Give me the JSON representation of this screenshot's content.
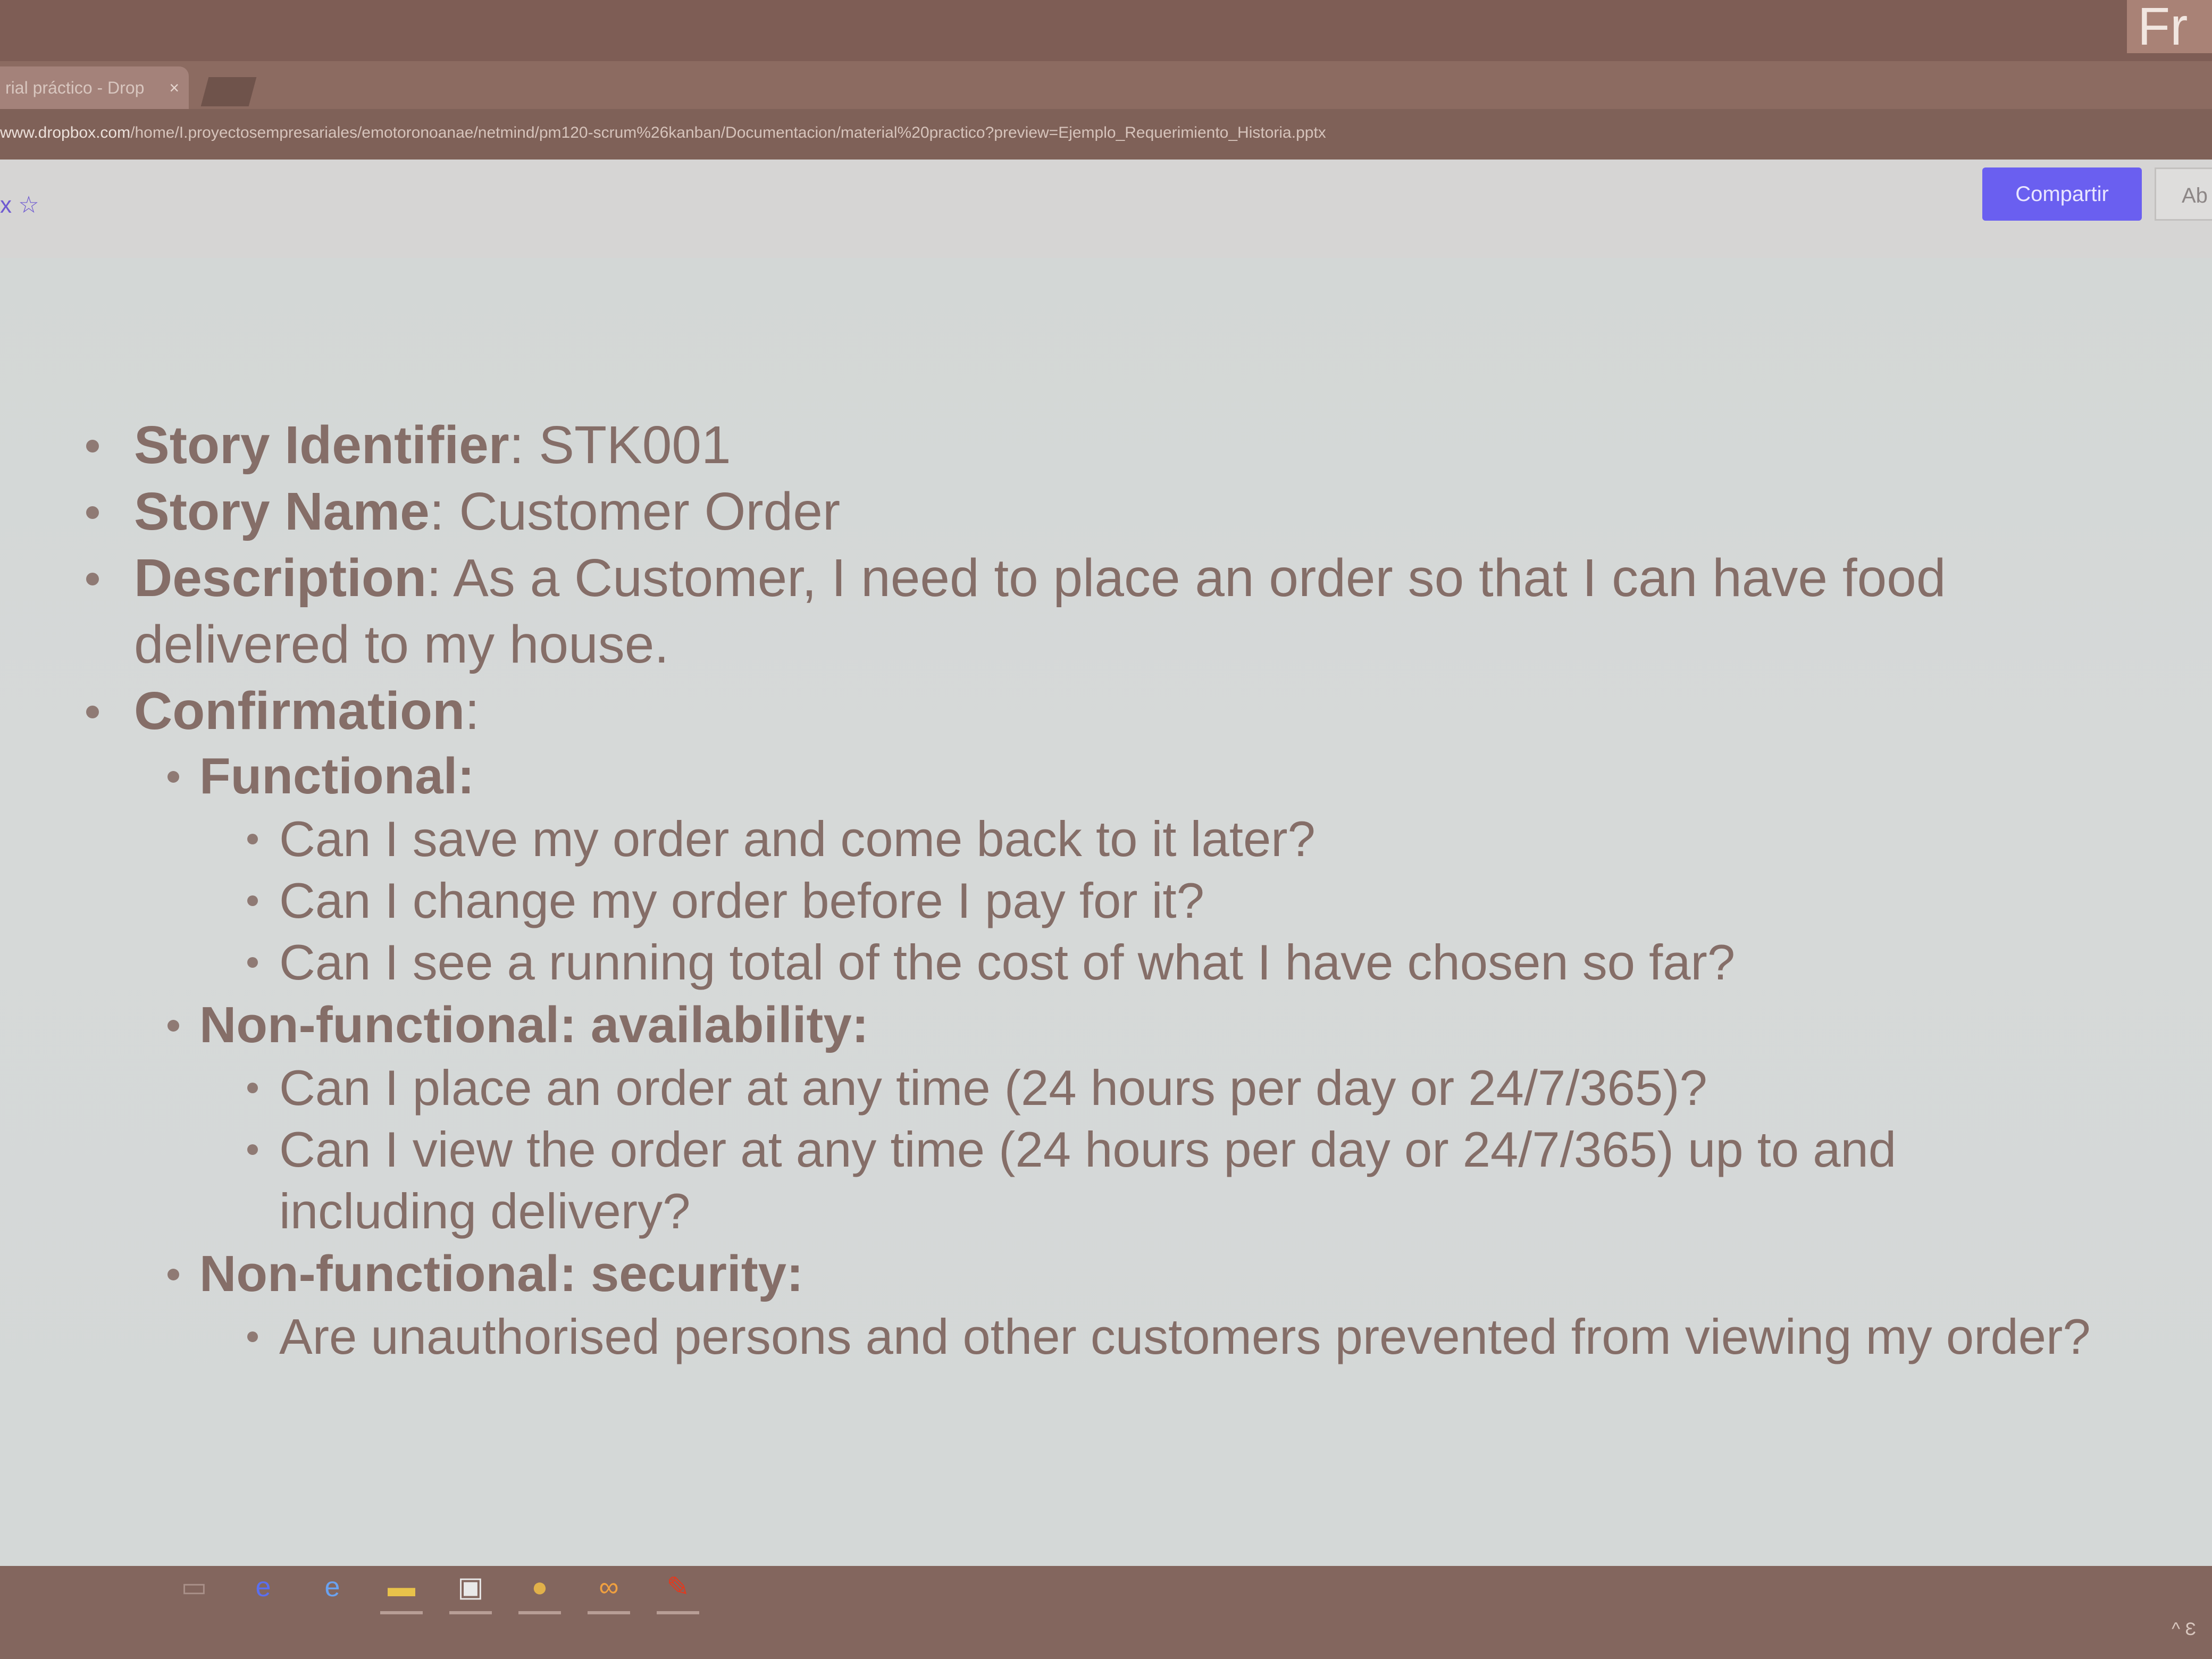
{
  "browser": {
    "tab_title": "rial práctico - Drop",
    "tab_close": "×",
    "url_domain": "www.dropbox.com",
    "url_path": "/home/I.proyectosempresariales/emotoronoanae/netmind/pm120-scrum%26kanban/Documentacion/material%20practico?preview=Ejemplo_Requerimiento_Historia.pptx",
    "corner_text": "Fr"
  },
  "toolbar": {
    "star_label": "x ☆",
    "share_label": "Compartir",
    "open_label": "Ab"
  },
  "slide": {
    "items": [
      {
        "label": "Story Identifier",
        "sep": ": ",
        "value": "STK001"
      },
      {
        "label": "Story Name",
        "sep": ": ",
        "value": "Customer Order"
      },
      {
        "label": "Description",
        "sep": ": ",
        "value": "As a Customer, I need to place an order so that I can have food delivered to my house."
      },
      {
        "label": "Confirmation",
        "sep": ":",
        "value": ""
      }
    ],
    "confirmation": [
      {
        "head": "Functional:",
        "items": [
          "Can I save my order and come back to it later?",
          "Can I change my order before I pay for it?",
          "Can I see a running total of the cost of what I have chosen so far?"
        ]
      },
      {
        "head": "Non-functional: availability:",
        "items": [
          "Can I place an order at any time (24 hours per day or 24/7/365)?",
          "Can I view the order at any time (24 hours per day or 24/7/365) up to and including delivery?"
        ]
      },
      {
        "head": "Non-functional: security:",
        "items": [
          "Are unauthorised persons and other customers prevented from viewing my order?"
        ]
      }
    ]
  },
  "taskbar": {
    "icons": [
      "task-view-icon",
      "edge-icon",
      "ie-icon",
      "file-explorer-icon",
      "store-icon",
      "chrome-icon",
      "app-icon",
      "pin-icon"
    ],
    "tray_text": "^ Ɛ"
  }
}
